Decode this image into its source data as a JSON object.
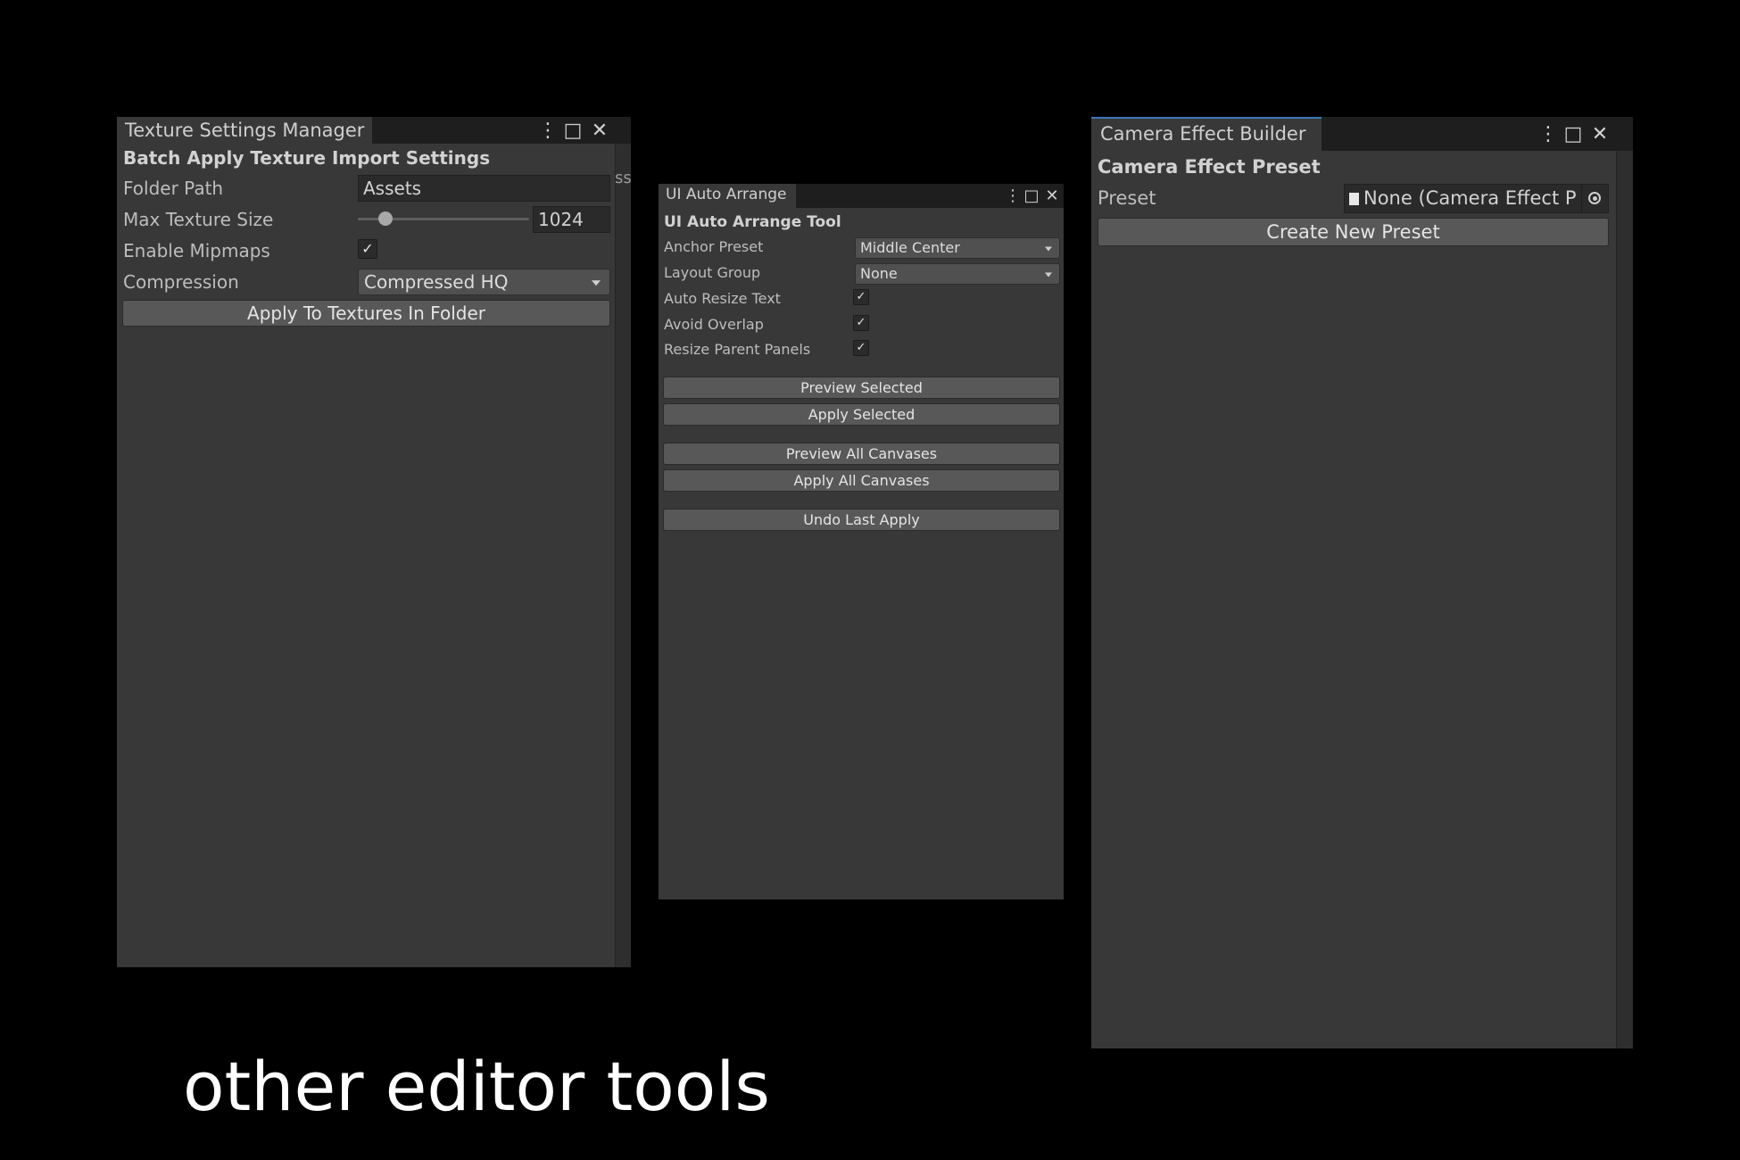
{
  "texture_window": {
    "tab_title": "Texture Settings Manager",
    "heading": "Batch Apply Texture Import Settings",
    "folder_path_label": "Folder Path",
    "folder_path_value": "Assets",
    "max_size_label": "Max Texture Size",
    "max_size_value": "1024",
    "max_size_fraction": 0.16,
    "mipmaps_label": "Enable Mipmaps",
    "mipmaps_checked": "✓",
    "compression_label": "Compression",
    "compression_value": "Compressed HQ",
    "apply_button": "Apply To Textures In Folder",
    "behind_text": "ss"
  },
  "ui_arrange_window": {
    "tab_title": "UI Auto Arrange",
    "heading": "UI Auto Arrange Tool",
    "anchor_label": "Anchor Preset",
    "anchor_value": "Middle Center",
    "layout_label": "Layout Group",
    "layout_value": "None",
    "auto_resize_label": "Auto Resize Text",
    "auto_resize_checked": "✓",
    "avoid_overlap_label": "Avoid Overlap",
    "avoid_overlap_checked": "✓",
    "resize_parent_label": "Resize Parent Panels",
    "resize_parent_checked": "✓",
    "preview_selected_button": "Preview Selected",
    "apply_selected_button": "Apply Selected",
    "preview_all_button": "Preview All Canvases",
    "apply_all_button": "Apply All Canvases",
    "undo_button": "Undo Last Apply"
  },
  "camera_window": {
    "tab_title": "Camera Effect Builder",
    "heading": "Camera Effect Preset",
    "preset_label": "Preset",
    "preset_value": "None (Camera Effect P",
    "create_button": "Create New Preset"
  },
  "window_controls": {
    "menu_glyph": "⋮",
    "maximize_glyph": "□",
    "close_glyph": "✕"
  },
  "caption": "other editor tools",
  "colors": {
    "background": "#000000",
    "panel": "#383838",
    "tab_accent": "#3a79bb",
    "button": "#585858"
  }
}
